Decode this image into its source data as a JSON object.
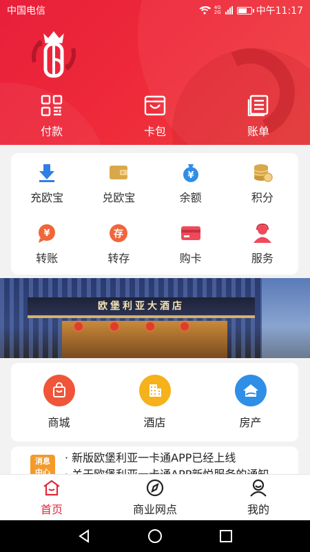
{
  "status_bar": {
    "carrier": "中国电信",
    "network": "4G 2G",
    "time": "中午11:17"
  },
  "header": {
    "background_color": "#e8233a",
    "logo_icon": "ob-crown-logo",
    "actions": [
      {
        "label": "付款",
        "icon": "qrcode-icon"
      },
      {
        "label": "卡包",
        "icon": "wallet-icon"
      },
      {
        "label": "账单",
        "icon": "bill-icon"
      }
    ]
  },
  "services": [
    {
      "label": "充欧宝",
      "icon": "download-arrow-icon",
      "color": "#2f7fe6"
    },
    {
      "label": "兑欧宝",
      "icon": "wallet-gold-icon",
      "color": "#d9a84a"
    },
    {
      "label": "余额",
      "icon": "money-bag-icon",
      "color": "#2f8ee6"
    },
    {
      "label": "积分",
      "icon": "coins-icon",
      "color": "#d9a84a"
    },
    {
      "label": "转账",
      "icon": "yuan-bubble-icon",
      "color": "#f0663a"
    },
    {
      "label": "转存",
      "icon": "deposit-icon",
      "color": "#f0663a"
    },
    {
      "label": "购卡",
      "icon": "card-icon",
      "color": "#ef4a5a"
    },
    {
      "label": "服务",
      "icon": "service-person-icon",
      "color": "#ef4a5a"
    }
  ],
  "banner": {
    "sign_text": "欧堡利亚大酒店"
  },
  "categories": [
    {
      "label": "商城",
      "icon": "shopping-bag-icon",
      "color": "#f0553a"
    },
    {
      "label": "酒店",
      "icon": "building-icon",
      "color": "#f5b21a"
    },
    {
      "label": "房产",
      "icon": "house-icon",
      "color": "#2f8ee6"
    }
  ],
  "news": {
    "badge": "消息\n中心",
    "items": [
      "· 新版欧堡利亚一卡通APP已经上线",
      "· 关于欧堡利亚一卡通APP新悦服务的通知"
    ]
  },
  "tabbar": {
    "active_color": "#e0283a",
    "tabs": [
      {
        "label": "首页",
        "icon": "home-icon",
        "active": true
      },
      {
        "label": "商业网点",
        "icon": "compass-icon",
        "active": false
      },
      {
        "label": "我的",
        "icon": "user-icon",
        "active": false
      }
    ]
  }
}
